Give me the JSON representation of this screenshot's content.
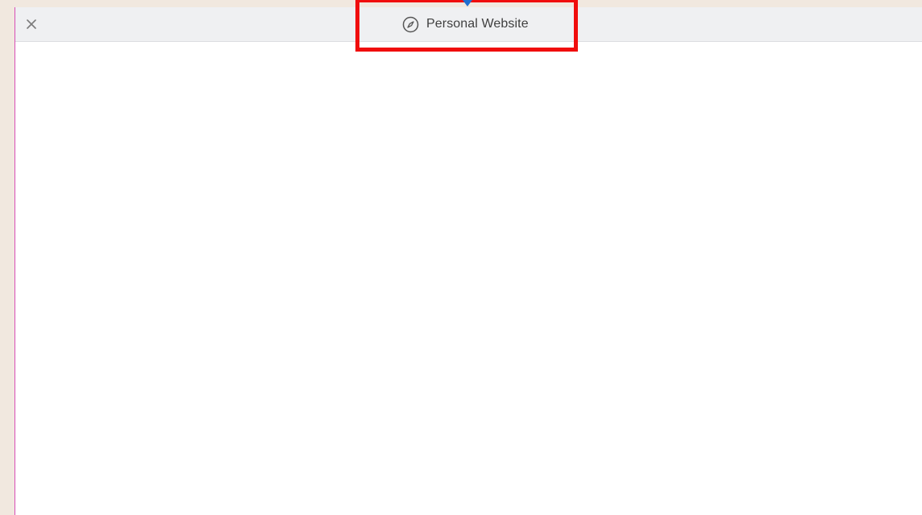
{
  "window": {
    "title": "Personal Website",
    "title_icon": "compass-icon",
    "close_icon": "close-icon"
  },
  "annotation": {
    "highlight_color": "#f00d0d",
    "pointer_color": "#1f6fd1"
  }
}
